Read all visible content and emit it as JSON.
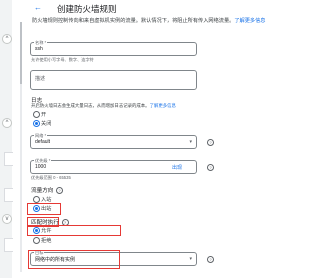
{
  "header": {
    "title": "创建防火墙规则"
  },
  "intro": {
    "text": "防火墙规则控制传向和来自虚拟机实例的流量。默认情况下，将阻止所有传入网络流量。",
    "link": "了解更多信息"
  },
  "name_field": {
    "label": "名称 *",
    "value": "ssh",
    "hint": "允许使用小写字母、数字、连字符"
  },
  "description_field": {
    "placeholder": "描述"
  },
  "logs": {
    "label": "日志",
    "hint": "开启防火墙日志会生成大量日志，从而增加日志记录的成本。",
    "link": "了解更多信息",
    "options": [
      "开",
      "关闭"
    ],
    "selected": 1
  },
  "network": {
    "label": "网络 *",
    "value": "default"
  },
  "priority": {
    "label": "优先级 *",
    "value": "1000",
    "hint": "优先级范围 0 - 65535",
    "action_link": "出现"
  },
  "direction": {
    "label": "流量方向",
    "options": [
      "入站",
      "出站"
    ],
    "selected": 1
  },
  "action": {
    "label": "匹配时执行",
    "options": [
      "允许",
      "拒绝"
    ],
    "selected": 0
  },
  "targets": {
    "label": "目标",
    "value": "网络中的所有实例"
  },
  "icons": {
    "help": "?",
    "dropdown": "▾",
    "back": "←",
    "expand_up": "^",
    "expand_down": "v"
  },
  "colors": {
    "accent": "#1a73e8",
    "highlight": "#e53935"
  }
}
